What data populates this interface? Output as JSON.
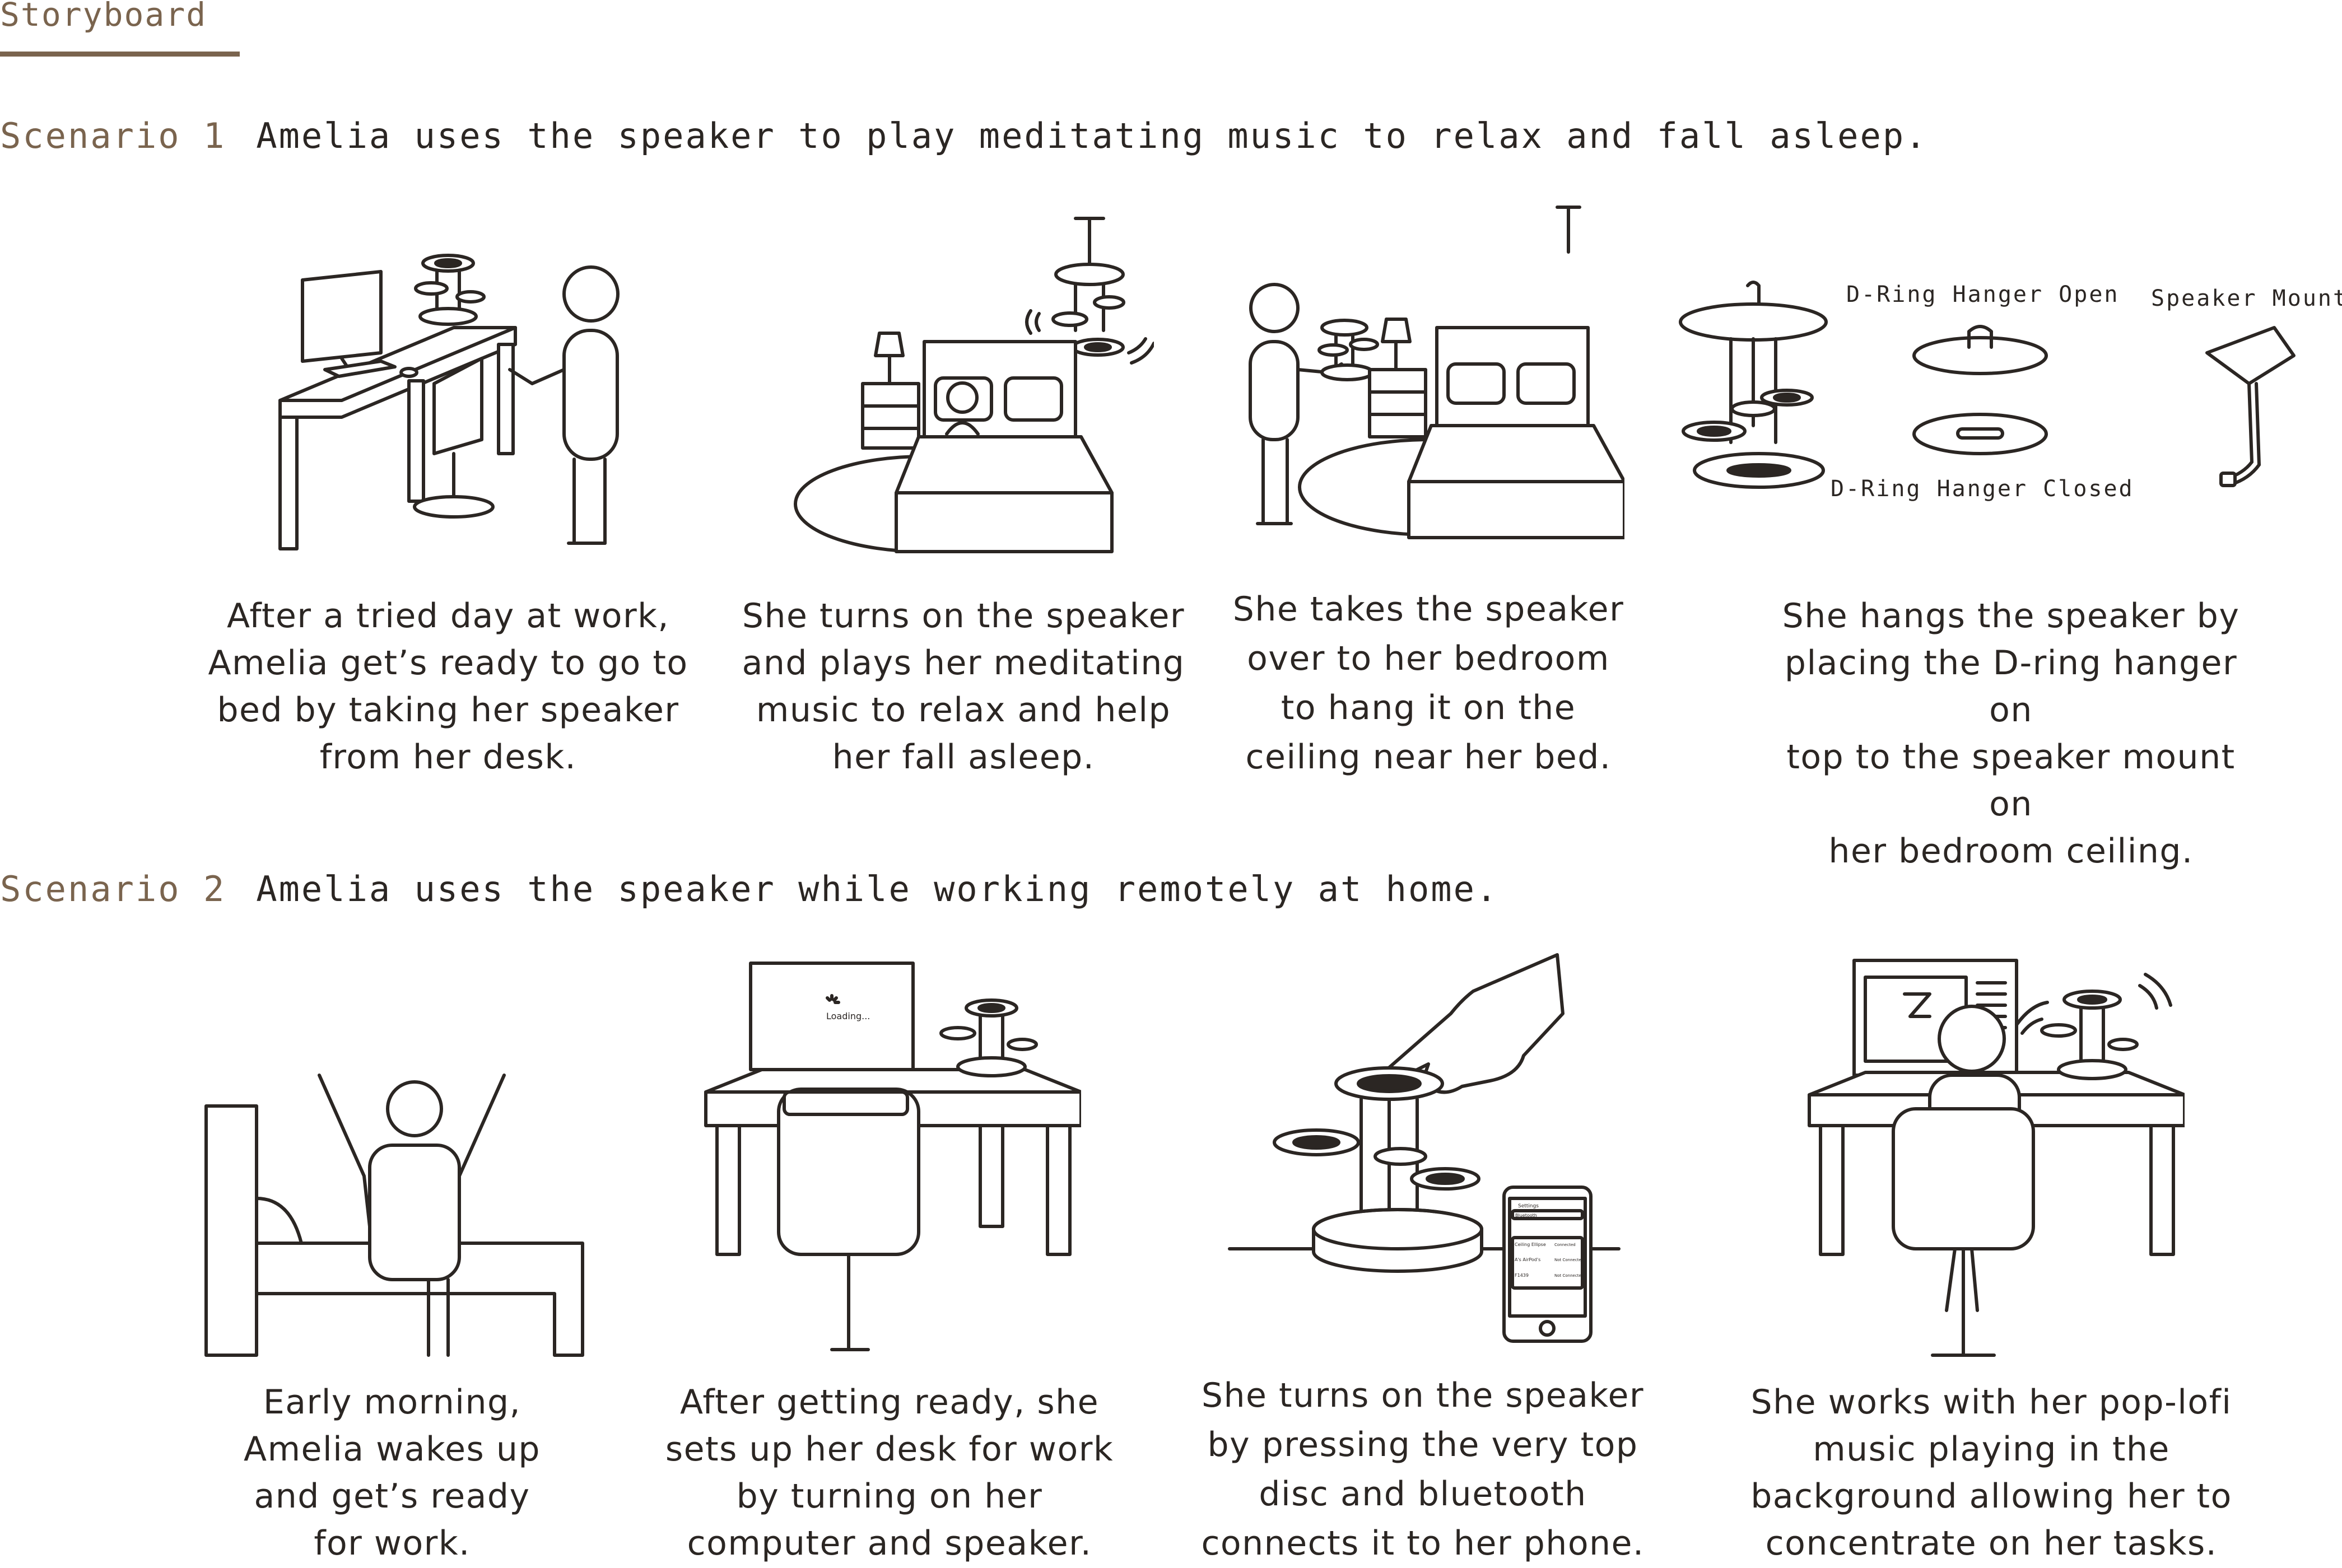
{
  "page": {
    "title": "Storyboard"
  },
  "scenario1": {
    "tag": "Scenario 1",
    "text": "Amelia uses the speaker to play meditating music to relax and fall asleep.",
    "labels": {
      "dring_open": "D-Ring Hanger Open",
      "dring_closed": "D-Ring Hanger Closed",
      "speaker_mount": "Speaker Mount"
    },
    "captions": [
      [
        "After a tried day at work,",
        "Amelia get’s ready to go to",
        "bed by taking her speaker",
        "from her desk."
      ],
      [
        "She turns on the speaker",
        "and plays her meditating",
        "music to relax and help",
        "her fall asleep."
      ],
      [
        "She takes the speaker",
        "over to her bedroom",
        "to hang it  on the",
        "ceiling near her bed."
      ],
      [
        "She hangs the speaker by",
        "placing the D-ring hanger on",
        "top to the speaker mount on",
        "her bedroom ceiling."
      ]
    ]
  },
  "scenario2": {
    "tag": "Scenario 2",
    "text": "Amelia uses the speaker while working remotely at home.",
    "screen": {
      "loading": "Loading..."
    },
    "phone": {
      "header": "Settings",
      "search": "Bluetooth",
      "rows": [
        [
          "Ceiling Ellipse",
          "Connected"
        ],
        [
          "A's AirPod's",
          "Not Connected"
        ],
        [
          "F1439",
          "Not Connected"
        ]
      ]
    },
    "captions": [
      [
        "Early morning,",
        "Amelia wakes up",
        "and get’s ready",
        "for work."
      ],
      [
        "After getting ready, she",
        "sets up her desk for work",
        "by turning on her",
        "computer and speaker."
      ],
      [
        "She turns on the speaker",
        "by pressing the very top",
        "disc and bluetooth",
        "connects it to her phone."
      ],
      [
        "She works with her pop-lofi",
        "music playing in the",
        "background allowing her to",
        "concentrate on her tasks."
      ]
    ]
  },
  "colors": {
    "accent": "#7a644e",
    "ink": "#2b2623",
    "background": "#ffffff"
  }
}
